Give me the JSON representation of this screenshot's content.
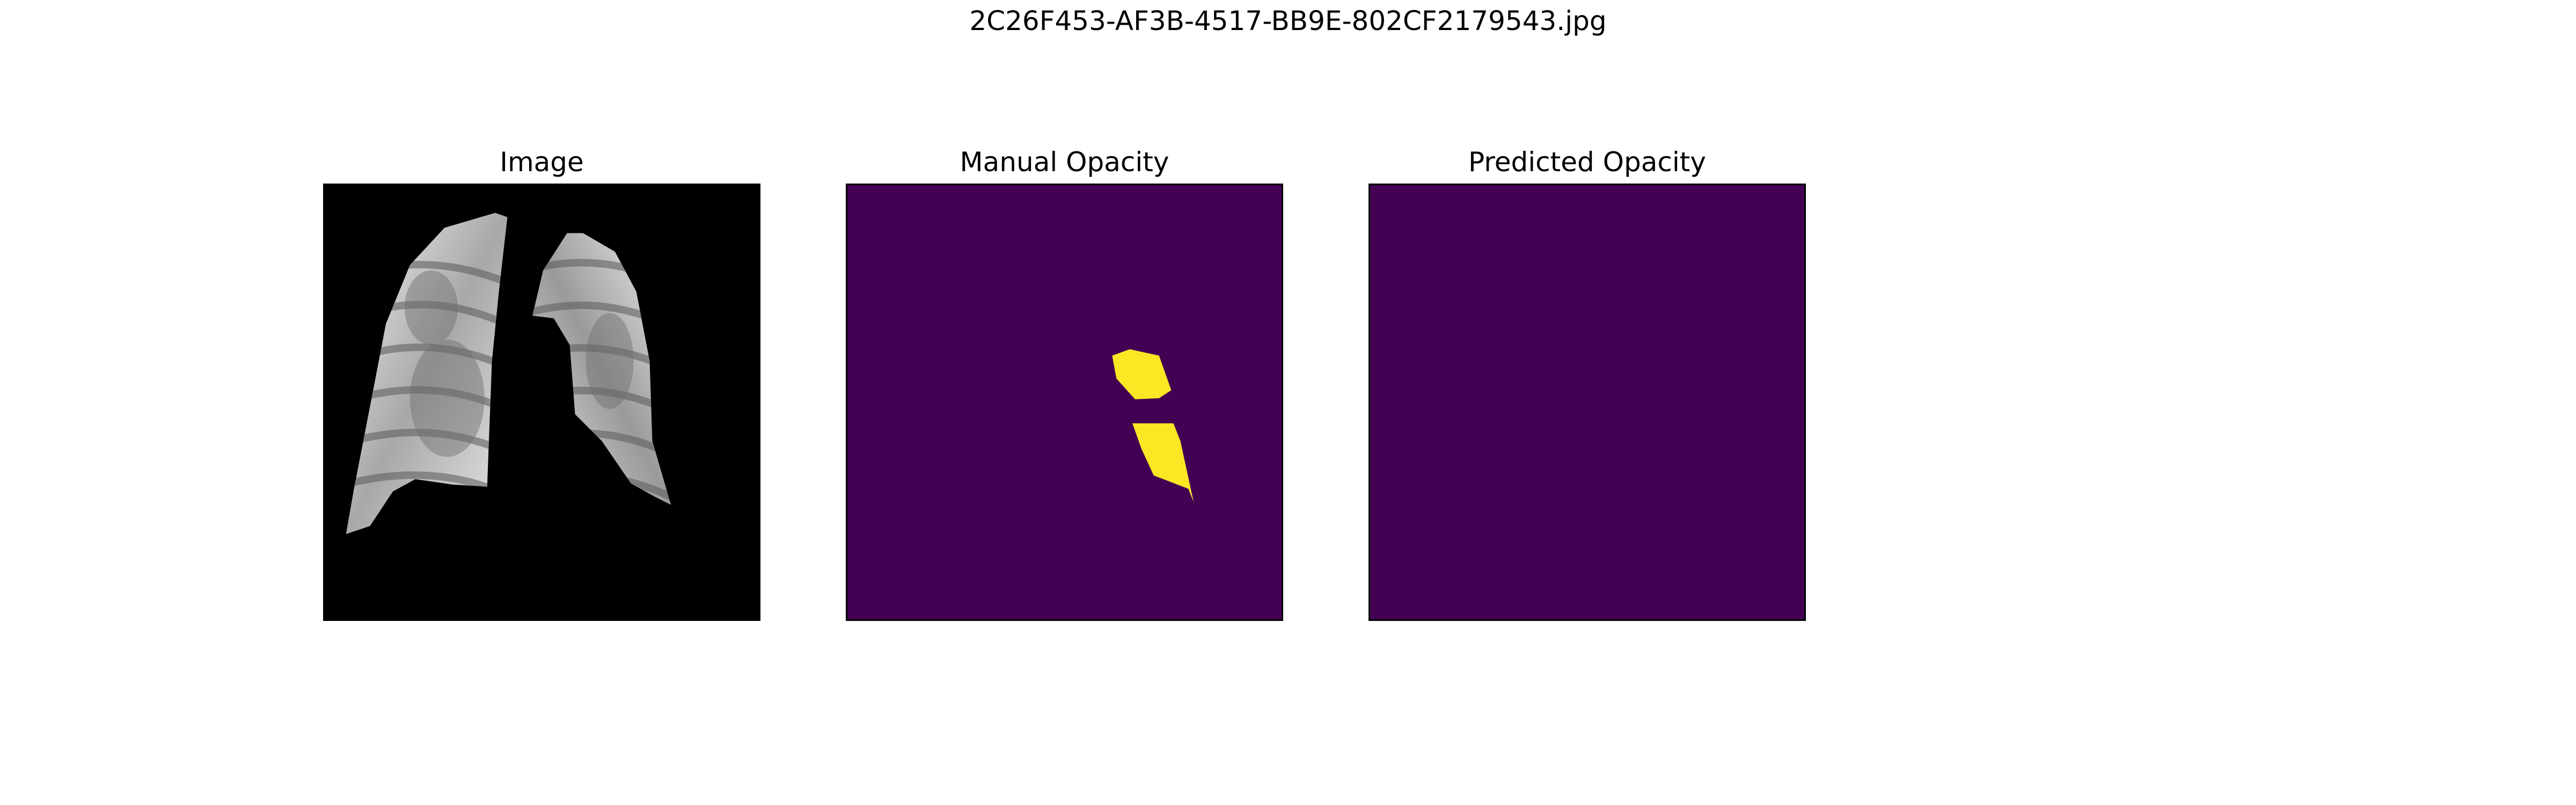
{
  "figure": {
    "title": "2C26F453-AF3B-4517-BB9E-802CF2179543.jpg"
  },
  "panels": [
    {
      "title": "Image",
      "kind": "grayscale-xray"
    },
    {
      "title": "Manual Opacity",
      "kind": "binary-mask",
      "has_opacity": true
    },
    {
      "title": "Predicted Opacity",
      "kind": "binary-mask",
      "has_opacity": false
    }
  ],
  "colors": {
    "mask_background": "#440154",
    "mask_foreground": "#fde725",
    "image_background": "#000000"
  }
}
